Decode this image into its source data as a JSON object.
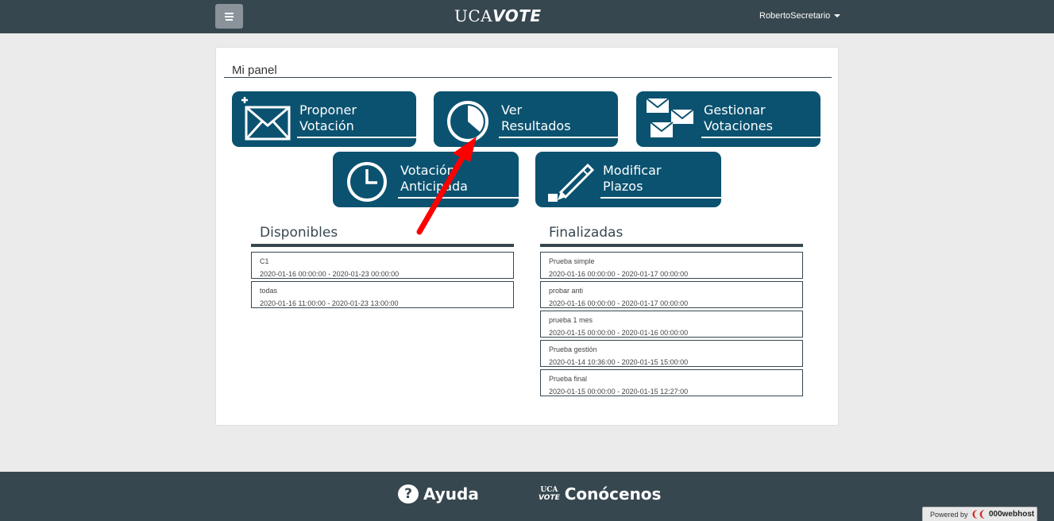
{
  "header": {
    "logo_prefix": "UCA",
    "logo_suffix": "VOTE",
    "user": "RobertoSecretario"
  },
  "panel": {
    "title": "Mi panel",
    "tiles": [
      {
        "line1": "Proponer",
        "line2": "Votación",
        "icon": "envelope-plus-icon"
      },
      {
        "line1": "Ver",
        "line2": "Resultados",
        "icon": "pie-chart-icon"
      },
      {
        "line1": "Gestionar",
        "line2": "Votaciones",
        "icon": "envelopes-icon"
      },
      {
        "line1": "Votación",
        "line2": "Anticipada",
        "icon": "clock-icon"
      },
      {
        "line1": "Modificar",
        "line2": "Plazos",
        "icon": "pencil-icon"
      }
    ]
  },
  "disponibles": {
    "title": "Disponibles",
    "items": [
      {
        "name": "C1",
        "dates": "2020-01-16 00:00:00 - 2020-01-23 00:00:00"
      },
      {
        "name": "todas",
        "dates": "2020-01-16 11:00:00 - 2020-01-23 13:00:00"
      }
    ]
  },
  "finalizadas": {
    "title": "Finalizadas",
    "items": [
      {
        "name": "Prueba simple",
        "dates": "2020-01-16 00:00:00 - 2020-01-17 00:00:00"
      },
      {
        "name": "probar anti",
        "dates": "2020-01-16 00:00:00 - 2020-01-17 00:00:00"
      },
      {
        "name": "prueba 1 mes",
        "dates": "2020-01-15 00:00:00 - 2020-01-16 00:00:00"
      },
      {
        "name": "Prueba gestión",
        "dates": "2020-01-14 10:36:00 - 2020-01-15 15:00:00"
      },
      {
        "name": "Prueba final",
        "dates": "2020-01-15 00:00:00 - 2020-01-15 12:27:00"
      }
    ]
  },
  "footer": {
    "help": "Ayuda",
    "about": "Conócenos",
    "about_logo_top": "UCA",
    "about_logo_bottom": "VOTE"
  },
  "powered": {
    "label": "Powered by",
    "host": "000webhost"
  },
  "colors": {
    "topbar": "#37474f",
    "tile": "#0b5270",
    "arrow": "#ff0000"
  }
}
